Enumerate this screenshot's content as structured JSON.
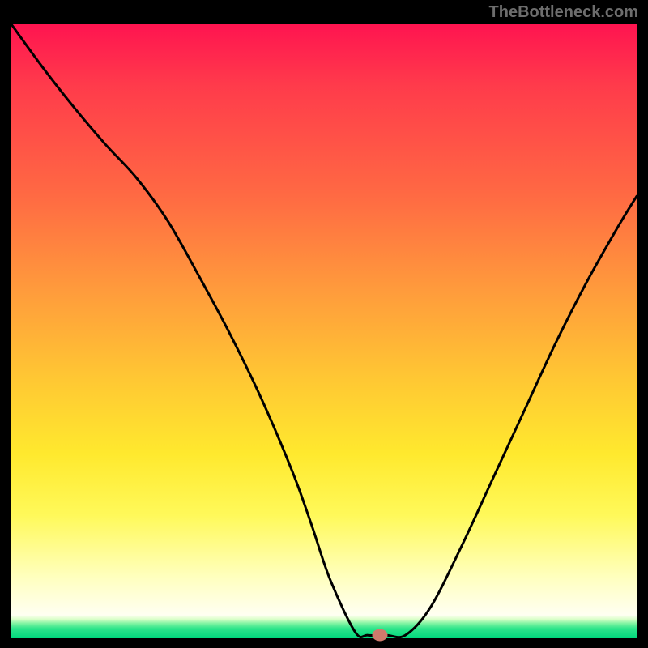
{
  "attribution": "TheBottleneck.com",
  "chart_data": {
    "type": "line",
    "title": "",
    "xlabel": "",
    "ylabel": "",
    "xlim": [
      0,
      100
    ],
    "ylim": [
      0,
      100
    ],
    "x": [
      0,
      5,
      10,
      15,
      20,
      25,
      30,
      35,
      40,
      45,
      48,
      51,
      55,
      57,
      60,
      63,
      67,
      72,
      77,
      82,
      87,
      92,
      97,
      100
    ],
    "values": [
      100,
      93,
      86.5,
      80.5,
      75,
      68,
      59,
      49.5,
      39,
      27,
      18.5,
      9.5,
      1,
      0.5,
      0.5,
      0.5,
      5,
      15,
      26,
      37,
      48,
      58,
      67,
      72
    ],
    "marker": {
      "x": 59,
      "y": 0.5
    },
    "colors": {
      "curve": "#000000",
      "marker": "#cf7a6c",
      "gradient_top": "#ff1450",
      "gradient_bottom": "#00d97d"
    }
  }
}
